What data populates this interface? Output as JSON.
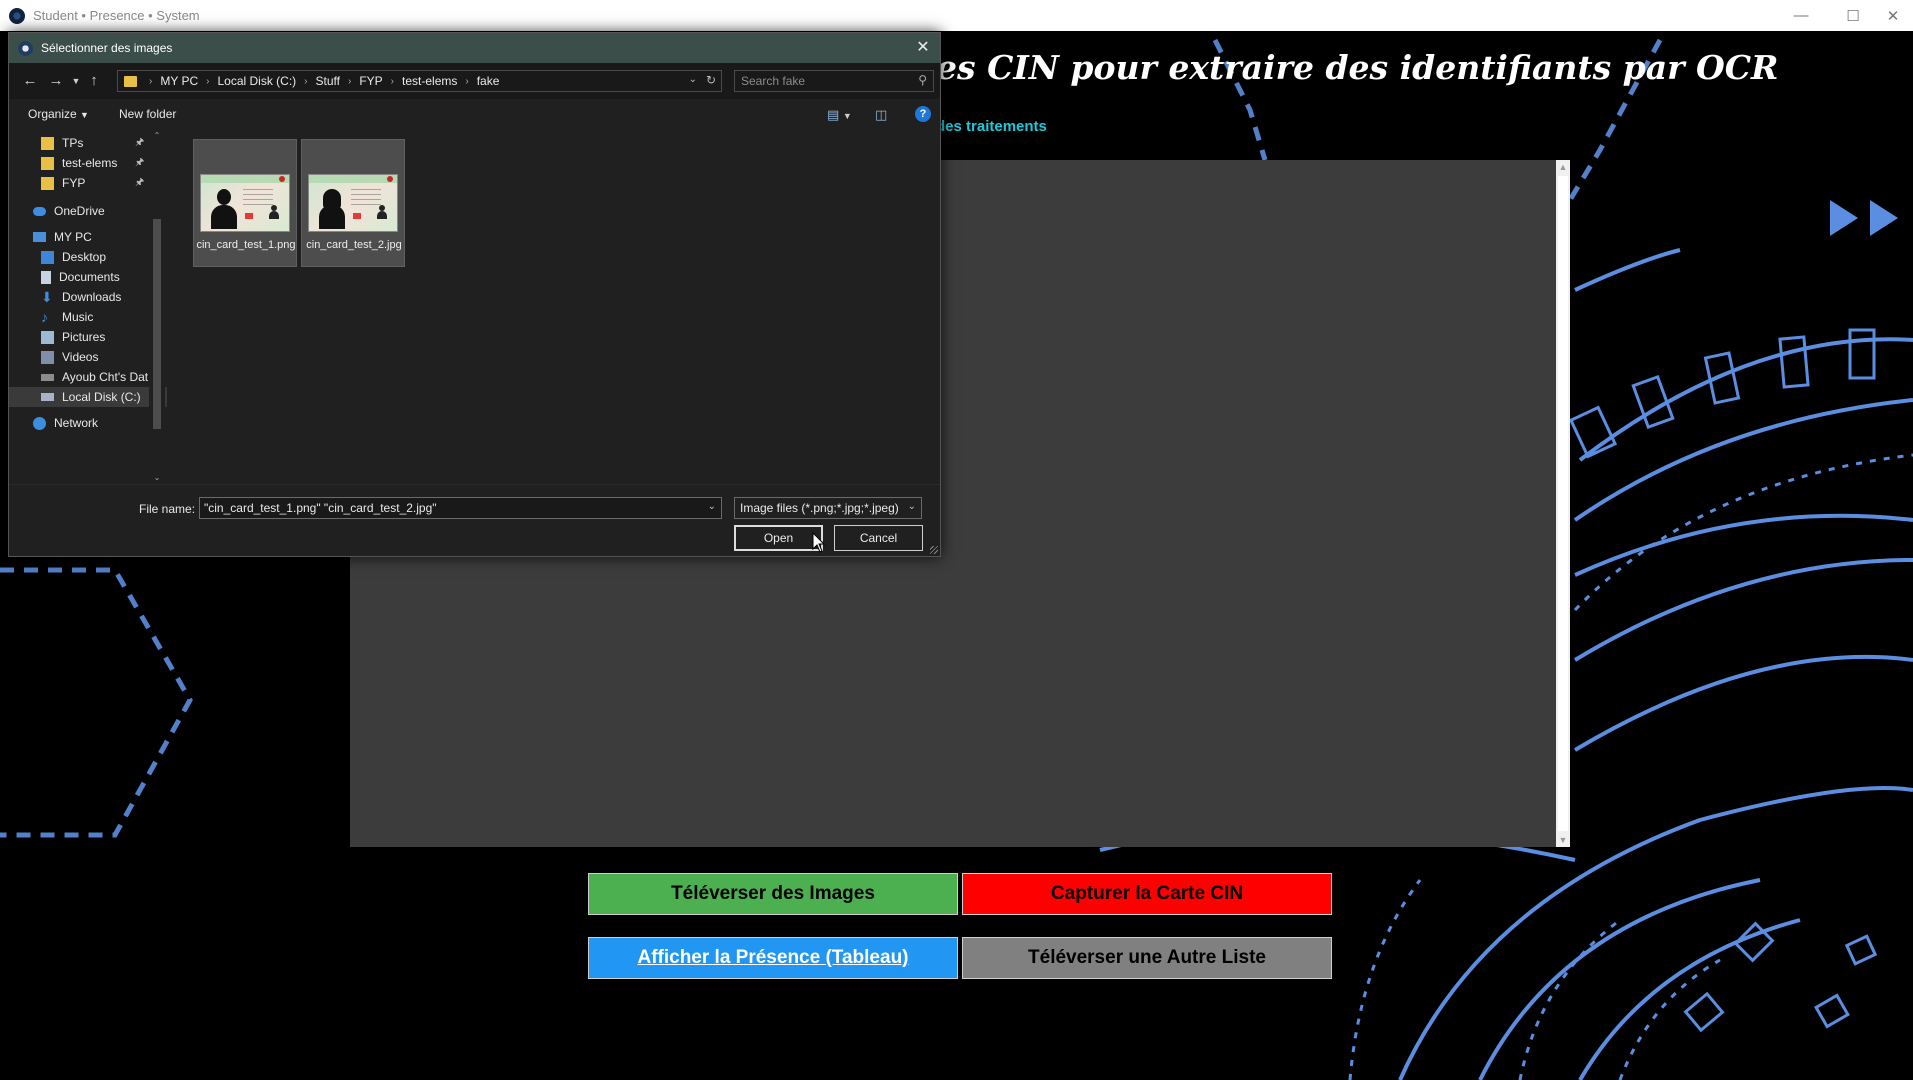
{
  "window": {
    "title": "Student • Presence • System",
    "icon": "app-logo-icon",
    "controls": [
      "minimize-icon",
      "maximize-icon",
      "close-icon"
    ]
  },
  "app": {
    "heading": "es CIN pour extraire des identifiants par OCR",
    "subtext": "des traitements",
    "buttons": {
      "upload": "Téléverser des Images",
      "capture": "Capturer la Carte CIN",
      "presence": "Afficher la Présence (Tableau)",
      "other_list": "Téléverser une Autre Liste"
    },
    "colors": {
      "upload": "#4caf50",
      "capture": "#ff0000",
      "presence": "#2196f3",
      "other_list": "#808080",
      "subtext": "#1ec8d8",
      "decoration": "#5b8ee0"
    }
  },
  "dialog": {
    "title": "Sélectionner des images",
    "breadcrumb": [
      "MY PC",
      "Local Disk (C:)",
      "Stuff",
      "FYP",
      "test-elems",
      "fake"
    ],
    "search_placeholder": "Search fake",
    "toolbar": {
      "organize": "Organize",
      "new_folder": "New folder"
    },
    "nav_items": [
      {
        "label": "TPs",
        "icon": "folder-icon",
        "pinned": true
      },
      {
        "label": "test-elems",
        "icon": "folder-icon",
        "pinned": true
      },
      {
        "label": "FYP",
        "icon": "folder-icon",
        "pinned": true
      },
      {
        "label": "OneDrive",
        "icon": "cloud-icon",
        "pinned": false
      },
      {
        "label": "MY PC",
        "icon": "computer-icon",
        "pinned": false
      },
      {
        "label": "Desktop",
        "icon": "desktop-icon",
        "pinned": false
      },
      {
        "label": "Documents",
        "icon": "documents-icon",
        "pinned": false
      },
      {
        "label": "Downloads",
        "icon": "download-icon",
        "pinned": false
      },
      {
        "label": "Music",
        "icon": "music-icon",
        "pinned": false
      },
      {
        "label": "Pictures",
        "icon": "pictures-icon",
        "pinned": false
      },
      {
        "label": "Videos",
        "icon": "videos-icon",
        "pinned": false
      },
      {
        "label": "Ayoub Cht's Dat",
        "icon": "drive-icon",
        "pinned": false
      },
      {
        "label": "Local Disk (C:)",
        "icon": "drive-icon",
        "pinned": false,
        "selected": true
      },
      {
        "label": "Network",
        "icon": "network-icon",
        "pinned": false
      }
    ],
    "files": [
      {
        "name": "cin_card_test_1.png",
        "gender": "male"
      },
      {
        "name": "cin_card_test_2.jpg",
        "gender": "female"
      }
    ],
    "file_name_label": "File name:",
    "file_name_value": "\"cin_card_test_1.png\" \"cin_card_test_2.jpg\"",
    "file_type": "Image files (*.png;*.jpg;*.jpeg)",
    "open_label": "Open",
    "cancel_label": "Cancel"
  }
}
